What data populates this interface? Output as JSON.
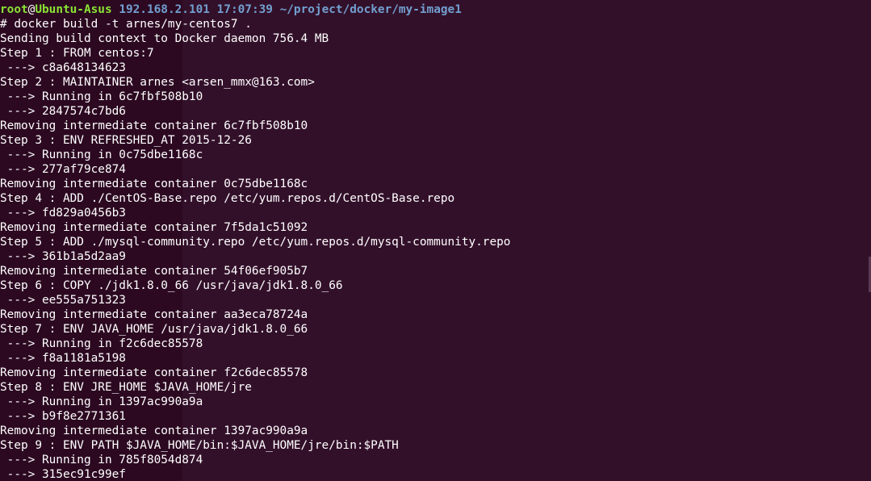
{
  "prompt_header": {
    "user": "root",
    "at": "@",
    "host": "Ubuntu-Asus",
    "ip": "192.168.2.101",
    "time": "17:07:39",
    "cwd": "~/project/docker/my-image1"
  },
  "output_lines": [
    "# docker build -t arnes/my-centos7 .",
    "Sending build context to Docker daemon 756.4 MB",
    "Step 1 : FROM centos:7",
    " ---> c8a648134623",
    "Step 2 : MAINTAINER arnes <arsen_mmx@163.com>",
    " ---> Running in 6c7fbf508b10",
    " ---> 2847574c7bd6",
    "Removing intermediate container 6c7fbf508b10",
    "Step 3 : ENV REFRESHED_AT 2015-12-26",
    " ---> Running in 0c75dbe1168c",
    " ---> 277af79ce874",
    "Removing intermediate container 0c75dbe1168c",
    "Step 4 : ADD ./CentOS-Base.repo /etc/yum.repos.d/CentOS-Base.repo",
    " ---> fd829a0456b3",
    "Removing intermediate container 7f5da1c51092",
    "Step 5 : ADD ./mysql-community.repo /etc/yum.repos.d/mysql-community.repo",
    " ---> 361b1a5d2aa9",
    "Removing intermediate container 54f06ef905b7",
    "Step 6 : COPY ./jdk1.8.0_66 /usr/java/jdk1.8.0_66",
    " ---> ee555a751323",
    "Removing intermediate container aa3eca78724a",
    "Step 7 : ENV JAVA_HOME /usr/java/jdk1.8.0_66",
    " ---> Running in f2c6dec85578",
    " ---> f8a1181a5198",
    "Removing intermediate container f2c6dec85578",
    "Step 8 : ENV JRE_HOME $JAVA_HOME/jre",
    " ---> Running in 1397ac990a9a",
    " ---> b9f8e2771361",
    "Removing intermediate container 1397ac990a9a",
    "Step 9 : ENV PATH $JAVA_HOME/bin:$JAVA_HOME/jre/bin:$PATH",
    " ---> Running in 785f8054d874",
    " ---> 315ec91c99ef"
  ],
  "colors": {
    "background": "#300a24",
    "text": "#ffffff",
    "user_host": "#8ae234",
    "path": "#729fcf"
  }
}
